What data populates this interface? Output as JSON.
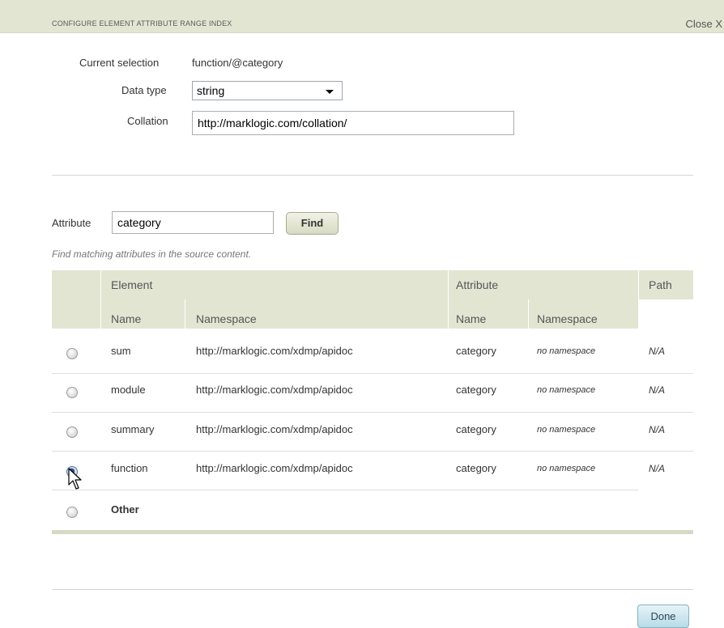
{
  "dialog": {
    "title": "CONFIGURE ELEMENT ATTRIBUTE RANGE INDEX",
    "close_label": "Close X"
  },
  "form": {
    "current_selection_label": "Current selection",
    "current_selection_value": "function/@category",
    "data_type_label": "Data type",
    "data_type_value": "string",
    "collation_label": "Collation",
    "collation_value": "http://marklogic.com/collation/"
  },
  "search": {
    "attribute_label": "Attribute",
    "attribute_value": "category",
    "find_label": "Find",
    "hint": "Find matching attributes in the source content."
  },
  "table": {
    "group_headers": {
      "element": "Element",
      "attribute": "Attribute",
      "path": "Path"
    },
    "sub_headers": {
      "element_name": "Name",
      "element_namespace": "Namespace",
      "attribute_name": "Name",
      "attribute_namespace": "Namespace"
    },
    "rows": [
      {
        "selected": false,
        "element_name": "sum",
        "element_namespace": "http://marklogic.com/xdmp/apidoc",
        "attribute_name": "category",
        "attribute_namespace": "no namespace",
        "path": "N/A"
      },
      {
        "selected": false,
        "element_name": "module",
        "element_namespace": "http://marklogic.com/xdmp/apidoc",
        "attribute_name": "category",
        "attribute_namespace": "no namespace",
        "path": "N/A"
      },
      {
        "selected": false,
        "element_name": "summary",
        "element_namespace": "http://marklogic.com/xdmp/apidoc",
        "attribute_name": "category",
        "attribute_namespace": "no namespace",
        "path": "N/A"
      },
      {
        "selected": true,
        "element_name": "function",
        "element_namespace": "http://marklogic.com/xdmp/apidoc",
        "attribute_name": "category",
        "attribute_namespace": "no namespace",
        "path": "N/A"
      }
    ],
    "other_label": "Other"
  },
  "footer": {
    "done_label": "Done"
  }
}
